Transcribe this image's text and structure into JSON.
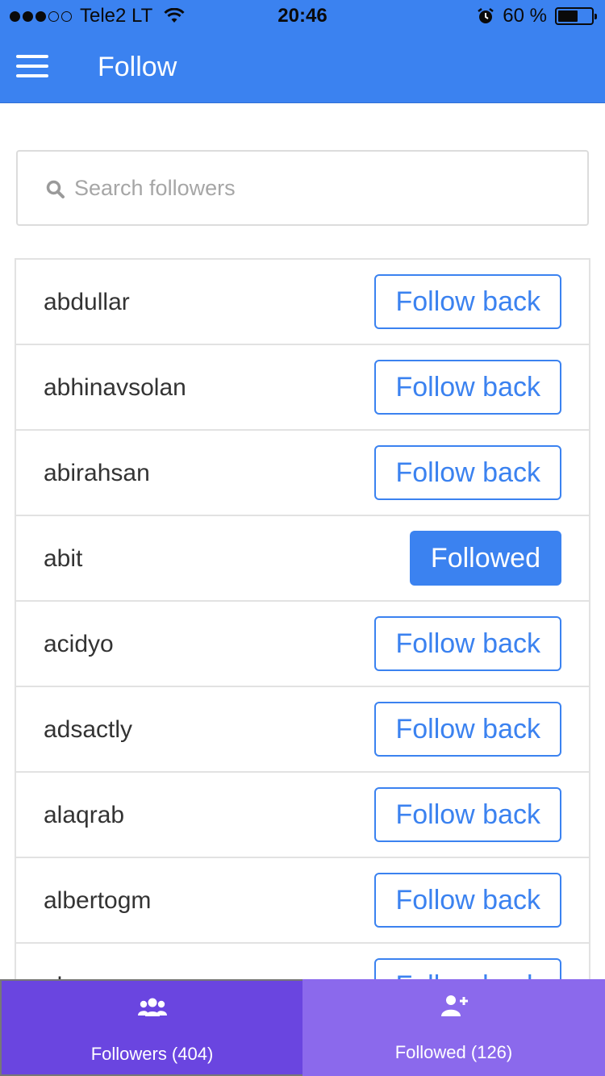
{
  "status_bar": {
    "carrier": "Tele2 LT",
    "time": "20:46",
    "battery_percent": "60 %",
    "battery_level": 0.6,
    "signal_bars_filled": 3,
    "signal_bars_total": 5,
    "icons": [
      "signal-dots-icon",
      "wifi-icon",
      "alarm-icon",
      "battery-icon"
    ]
  },
  "header": {
    "title": "Follow",
    "menu_icon": "hamburger-menu-icon",
    "background_color": "#3b82f0"
  },
  "search": {
    "placeholder": "Search followers",
    "value": "",
    "icon": "search-icon"
  },
  "followers": [
    {
      "username": "abdullar",
      "button_label": "Follow back",
      "state": "follow"
    },
    {
      "username": "abhinavsolan",
      "button_label": "Follow back",
      "state": "follow"
    },
    {
      "username": "abirahsan",
      "button_label": "Follow back",
      "state": "follow"
    },
    {
      "username": "abit",
      "button_label": "Followed",
      "state": "followed"
    },
    {
      "username": "acidyo",
      "button_label": "Follow back",
      "state": "follow"
    },
    {
      "username": "adsactly",
      "button_label": "Follow back",
      "state": "follow"
    },
    {
      "username": "alaqrab",
      "button_label": "Follow back",
      "state": "follow"
    },
    {
      "username": "albertogm",
      "button_label": "Follow back",
      "state": "follow"
    },
    {
      "username": "al...",
      "button_label": "Follow back",
      "state": "follow"
    }
  ],
  "tabs": [
    {
      "label": "Followers (404)",
      "icon": "followers-group-icon",
      "active": true
    },
    {
      "label": "Followed (126)",
      "icon": "add-user-icon",
      "active": false
    }
  ],
  "colors": {
    "accent": "#3b82f0",
    "tab_active": "#6a45e0",
    "tab_inactive": "#8b69ec"
  }
}
